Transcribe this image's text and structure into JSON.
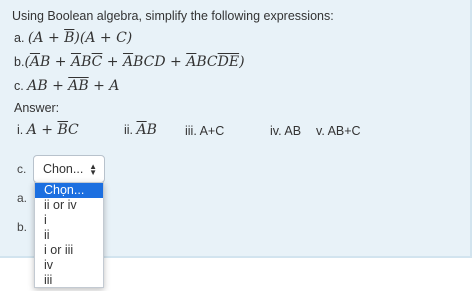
{
  "question": {
    "instruction": "Using Boolean algebra, simplify the following expressions:",
    "expr_a_prefix": "a.",
    "expr_b_prefix": "b.",
    "expr_c_prefix": "c.",
    "answer_label": "Answer:"
  },
  "choices": {
    "i_label": "i.",
    "ii_label": "ii.",
    "iii": "iii. A+C",
    "iv": "iv.  AB",
    "v": "v. AB+C"
  },
  "rows": {
    "c_label": "c.",
    "a_label": "a.",
    "b_label": "b."
  },
  "select": {
    "value": "Chon...",
    "options": [
      "Chọn...",
      "ii or iv",
      "i",
      "ii",
      "i or iii",
      "iv",
      "iii"
    ],
    "selected_index": 0
  },
  "colors": {
    "panel_bg": "#e8f2f8",
    "selected_option_bg": "#1c6fe0"
  }
}
